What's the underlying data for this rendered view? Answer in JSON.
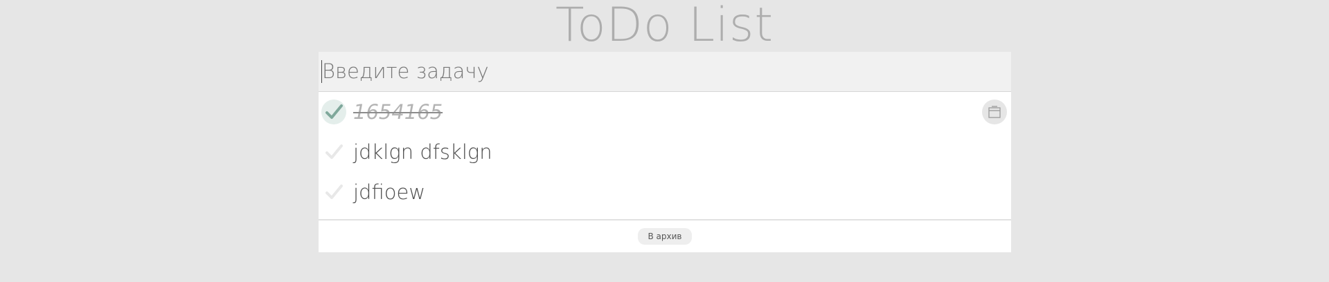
{
  "app": {
    "title": "ToDo List"
  },
  "input": {
    "placeholder": "Введите задачу",
    "value": ""
  },
  "todos": [
    {
      "text": "1654165",
      "done": true,
      "check_icon": "checkmark-icon",
      "action_icon": "archive-icon"
    },
    {
      "text": "jdklgn dfsklgn",
      "done": false,
      "check_icon": "checkmark-icon"
    },
    {
      "text": "jdfioew",
      "done": false,
      "check_icon": "checkmark-icon"
    }
  ],
  "footer": {
    "archive_label": "В архив"
  },
  "colors": {
    "background": "#e6e6e6",
    "check_done": "#7fa89b",
    "check_pending": "#e8e8e8"
  }
}
